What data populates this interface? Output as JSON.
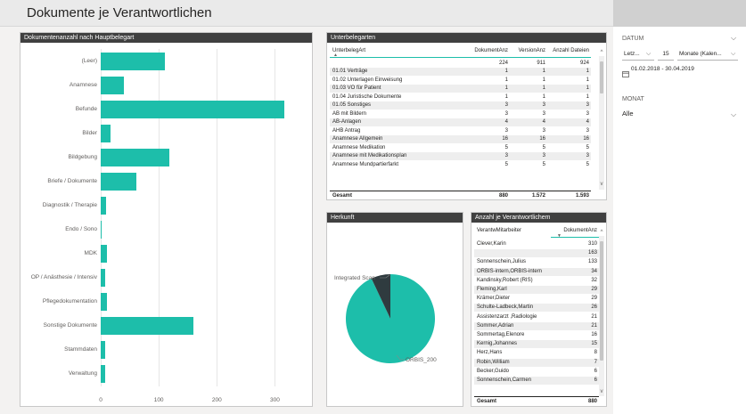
{
  "page": {
    "title": "Dokumente je Verantwortlichen"
  },
  "hauptbelegart_chart": {
    "header": "Dokumentenanzahl nach Hauptbelegart",
    "chart_data": {
      "type": "bar",
      "orientation": "horizontal",
      "categories": [
        "(Leer)",
        "Anamnese",
        "Befunde",
        "Bilder",
        "Bildgebung",
        "Briefe / Dokumente",
        "Diagnostik / Therapie",
        "Endo / Sono",
        "MDK",
        "OP / Anästhesie / Intensiv",
        "Pflegedokumentation",
        "Sonstige Dokumente",
        "Stammdaten",
        "Verwaltung"
      ],
      "values": [
        110,
        40,
        316,
        17,
        118,
        62,
        9,
        2,
        11,
        8,
        11,
        160,
        7,
        8
      ],
      "xlim": [
        0,
        350
      ],
      "xticks": [
        0,
        100,
        200,
        300
      ],
      "grid": true,
      "bar_color": "#1dbeaa"
    }
  },
  "unterbelegarten": {
    "header": "Unterbelegarten",
    "columns": [
      "UnterbelegArt",
      "DokumentAnz",
      "VersionAnz",
      "Anzahl Dateien"
    ],
    "first_row": [
      "",
      "224",
      "911",
      "924"
    ],
    "rows": [
      [
        "01.01 Verträge",
        "1",
        "1",
        "1"
      ],
      [
        "01.02 Unterlagen Einweisung",
        "1",
        "1",
        "1"
      ],
      [
        "01.03 VO für Patient",
        "1",
        "1",
        "1"
      ],
      [
        "01.04 Juristische Dokumente",
        "1",
        "1",
        "1"
      ],
      [
        "01.05 Sonstiges",
        "3",
        "3",
        "3"
      ],
      [
        "AB mit Bildern",
        "3",
        "3",
        "3"
      ],
      [
        "AB-Anlagen",
        "4",
        "4",
        "4"
      ],
      [
        "AHB Antrag",
        "3",
        "3",
        "3"
      ],
      [
        "Anamnese Allgemein",
        "16",
        "16",
        "16"
      ],
      [
        "Anamnese Medikation",
        "5",
        "5",
        "5"
      ],
      [
        "Anamnese mit Medikationsplan",
        "3",
        "3",
        "3"
      ],
      [
        "Anamnese Mundpartierfarkt",
        "5",
        "5",
        "5"
      ]
    ],
    "total": [
      "Gesamt",
      "880",
      "1.572",
      "1.593"
    ]
  },
  "herkunft": {
    "header": "Herkunft",
    "chart_data": {
      "type": "pie",
      "labels": [
        "ORBIS_200",
        "Integrated Scan"
      ],
      "values": [
        93,
        7
      ],
      "colors": [
        "#1dbeaa",
        "#2f3b3f"
      ]
    }
  },
  "verantwortliche": {
    "header": "Anzahl je Verantwortlichem",
    "columns": [
      "VerantwMitarbeiter",
      "DokumentAnz"
    ],
    "rows": [
      [
        "Clever,Karin",
        "310"
      ],
      [
        "",
        "163"
      ],
      [
        "Sonnenschein,Julius",
        "133"
      ],
      [
        "ORBIS-intern,ORBIS-intern",
        "34"
      ],
      [
        "Kandinsky,Robert (RIS)",
        "32"
      ],
      [
        "Fleming,Karl",
        "29"
      ],
      [
        "Krämer,Dieter",
        "29"
      ],
      [
        "Schulte-Ladbeck,Martin",
        "26"
      ],
      [
        "Assistenzarzt ,Radiologie",
        "21"
      ],
      [
        "Sommer,Adrian",
        "21"
      ],
      [
        "Sommertag,Elenore",
        "16"
      ],
      [
        "Kernig,Johannes",
        "15"
      ],
      [
        "Herz,Hans",
        "8"
      ],
      [
        "Robin,William",
        "7"
      ],
      [
        "Becker,Guido",
        "6"
      ],
      [
        "Sonnenschein,Carmen",
        "6"
      ]
    ],
    "total": [
      "Gesamt",
      "880"
    ]
  },
  "filters": {
    "datum_label": "DATUM",
    "relative_option": "Letz...",
    "relative_count": "15",
    "relative_unit": "Monate (Kalen...",
    "date_range": "01.02.2018 - 30.04.2019",
    "monat_label": "MONAT",
    "monat_value": "Alle"
  }
}
